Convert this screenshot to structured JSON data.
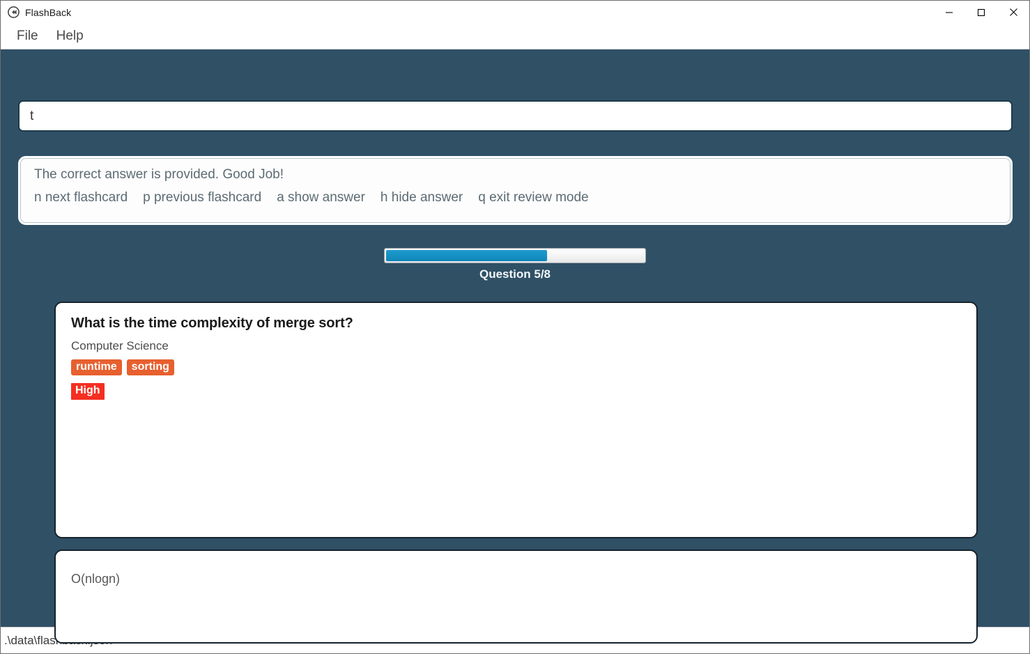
{
  "window": {
    "title": "FlashBack",
    "app_icon": "rewind-circle-icon",
    "controls": {
      "minimize": "minimize-icon",
      "maximize": "maximize-icon",
      "close": "close-icon"
    }
  },
  "menu": {
    "items": [
      {
        "label": "File"
      },
      {
        "label": "Help"
      }
    ]
  },
  "command": {
    "value": "t",
    "placeholder": ""
  },
  "help": {
    "message": "The correct answer is provided. Good Job!",
    "shortcuts": [
      {
        "label": "n next flashcard"
      },
      {
        "label": "p previous flashcard"
      },
      {
        "label": "a show answer"
      },
      {
        "label": "h hide answer"
      },
      {
        "label": "q exit review mode"
      }
    ]
  },
  "progress": {
    "label": "Question 5/8",
    "current": 5,
    "total": 8,
    "percent": "62.5%",
    "fill_color": "#128ABC",
    "track_color": "#F3F3F3"
  },
  "flashcard": {
    "question": "What is the time complexity of merge sort?",
    "category": "Computer Science",
    "tags": [
      {
        "label": "runtime"
      },
      {
        "label": "sorting"
      }
    ],
    "tag_color": "#E7602F",
    "difficulty": "High",
    "difficulty_color": "#F52F21"
  },
  "answer": {
    "text": "O(nlogn)"
  },
  "status": {
    "path": ".\\data\\flashback.json"
  },
  "theme": {
    "background": "#2F5065",
    "panel": "#FFFFFF",
    "panel_border": "#16222A"
  }
}
